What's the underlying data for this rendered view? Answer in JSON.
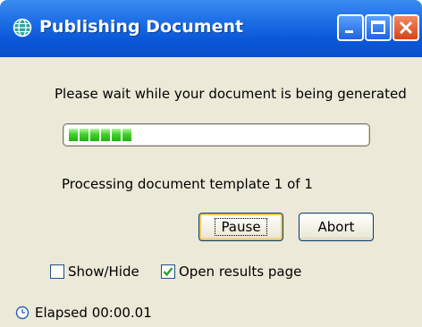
{
  "window": {
    "title": "Publishing Document",
    "title_icon": "globe-icon",
    "controls": {
      "minimize": "minimize-icon",
      "maximize": "maximize-icon",
      "close": "close-icon"
    },
    "colors": {
      "titlebar": "#0a58d8",
      "client_bg": "#ece9d8",
      "progress_green": "#41d22a",
      "close_button": "#d74418"
    }
  },
  "dialog": {
    "message": "Please wait while your document is being generated",
    "progress": {
      "segments_filled": 6,
      "fraction": 0.2
    },
    "status": "Processing document template 1 of 1",
    "buttons": {
      "pause_label": "Pause",
      "abort_label": "Abort"
    },
    "checkboxes": {
      "show_hide": {
        "label": "Show/Hide",
        "checked": false
      },
      "open_results": {
        "label": "Open results page",
        "checked": true
      }
    },
    "elapsed": "Elapsed 00:00.01",
    "elapsed_icon": "clock-icon"
  }
}
